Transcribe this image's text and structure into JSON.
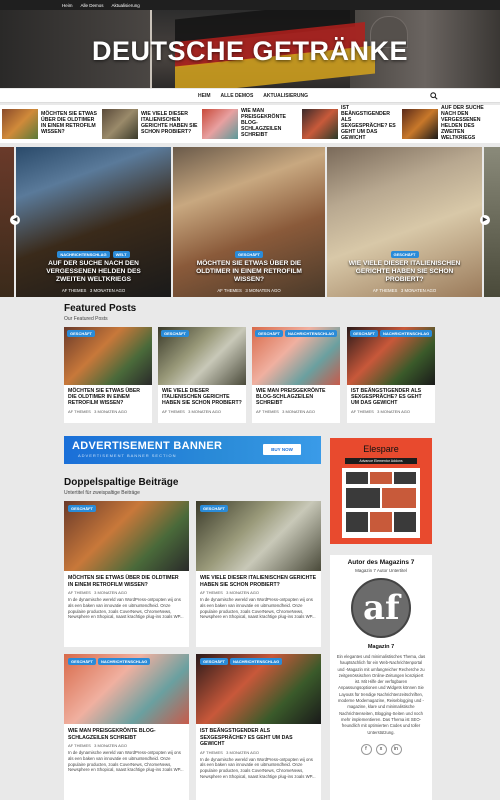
{
  "topbar": {
    "items": [
      "Heim",
      "Alle Demos",
      "Aktualisierung"
    ]
  },
  "site": {
    "title": "DEUTSCHE GETRÄNKE"
  },
  "nav": {
    "items": [
      "HEIM",
      "ALLE DEMOS",
      "AKTUALISIERUNG"
    ],
    "search_icon": "search-icon"
  },
  "ticker": [
    {
      "title": "MÖCHTEN SIE ETWAS ÜBER DIE OLDTIMER IN EINEM RETROFILM WISSEN?"
    },
    {
      "title": "WIE VIELE DIESER ITALIENISCHEN GERICHTE HABEN SIE SCHON PROBIERT?"
    },
    {
      "title": "WIE MAN PREISGEKRÖNTE BLOG-SCHLAGZEILEN SCHREIBT"
    },
    {
      "title": "IST BEÄNGSTIGENDER ALS SEXGESPRÄCHE? ES GEHT UM DAS GEWICHT"
    },
    {
      "title": "AUF DER SUCHE NACH DEN VERGESSENEN HELDEN DES ZWEITEN WELTKRIEGS"
    }
  ],
  "slides": [
    {
      "badges": [
        "NACHRICHTENSCHLAG",
        "WELT"
      ],
      "title": "AUF DER SUCHE NACH DEN VERGESSENEN HELDEN DES ZWEITEN WELTKRIEGS",
      "author": "AF THEMES",
      "date": "3 MONATEN AGO"
    },
    {
      "badges": [
        "GESCHÄFT"
      ],
      "title": "MÖCHTEN SIE ETWAS ÜBER DIE OLDTIMER IN EINEM RETROFILM WISSEN?",
      "author": "AF THEMES",
      "date": "3 MONATEN AGO"
    },
    {
      "badges": [
        "GESCHÄFT"
      ],
      "title": "WIE VIELE DIESER ITALIENISCHEN GERICHTE HABEN SIE SCHON PROBIERT?",
      "author": "AF THEMES",
      "date": "3 MONATEN AGO"
    }
  ],
  "featured": {
    "title": "Featured Posts",
    "subtitle": "Our Featured Posts",
    "posts": [
      {
        "badges": [
          "GESCHÄFT"
        ],
        "title": "MÖCHTEN SIE ETWAS ÜBER DIE OLDTIMER IN EINEM RETROFILM WISSEN?",
        "author": "AF THEMES",
        "date": "3 MONATEN AGO"
      },
      {
        "badges": [
          "GESCHÄFT"
        ],
        "title": "WIE VIELE DIESER ITALIENISCHEN GERICHTE HABEN SIE SCHON PROBIERT?",
        "author": "AF THEMES",
        "date": "3 MONATEN AGO"
      },
      {
        "badges": [
          "GESCHÄFT",
          "NACHRICHTENSCHLAG"
        ],
        "title": "WIE MAN PREISGEKRÖNTE BLOG-SCHLAGZEILEN SCHREIBT",
        "author": "AF THEMES",
        "date": "3 MONATEN AGO"
      },
      {
        "badges": [
          "GESCHÄFT",
          "NACHRICHTENSCHLAG"
        ],
        "title": "IST BEÄNGSTIGENDER ALS SEXGESPRÄCHE? ES GEHT UM DAS GEWICHT",
        "author": "AF THEMES",
        "date": "3 MONATEN AGO"
      }
    ]
  },
  "ad": {
    "title": "ADVERTISEMENT BANNER",
    "subtitle": "ADVERTISEMENT BANNER SECTION",
    "button": "BUY NOW"
  },
  "twocol": {
    "title": "Doppelspaltige Beiträge",
    "subtitle": "Untertitel für zweispaltige Beiträge",
    "posts": [
      {
        "badges": [
          "GESCHÄFT"
        ],
        "title": "MÖCHTEN SIE ETWAS ÜBER DIE OLDTIMER IN EINEM RETROFILM WISSEN?",
        "author": "AF THEMES",
        "date": "3 MONATEN AGO",
        "excerpt": "In de dynamische wereld van WordPress-ontpopten wij ons als een baken van innovatie en uitmuntendheid. Onze populaire producten, zoals CoverNews, ChromeNews, Newsphere en Shopical, naast krachtige plug-ins zoals WP..."
      },
      {
        "badges": [
          "GESCHÄFT"
        ],
        "title": "WIE VIELE DIESER ITALIENISCHEN GERICHTE HABEN SIE SCHON PROBIERT?",
        "author": "AF THEMES",
        "date": "3 MONATEN AGO",
        "excerpt": "In de dynamische wereld van WordPress-ontpopten wij ons als een baken van innovatie en uitmuntendheid. Onze populaire producten, zoals CoverNews, ChromeNews, Newsphere en Shopical, naast krachtige plug-ins zoals WP..."
      },
      {
        "badges": [
          "GESCHÄFT",
          "NACHRICHTENSCHLAG"
        ],
        "title": "WIE MAN PREISGEKRÖNTE BLOG-SCHLAGZEILEN SCHREIBT",
        "author": "AF THEMES",
        "date": "3 MONATEN AGO",
        "excerpt": "In de dynamische wereld van WordPress-ontpopten wij ons als een baken van innovatie en uitmuntendheid. Onze populaire producten, zoals CoverNews, ChromeNews, Newsphere en Shopical, naast krachtige plug-ins zoals WP..."
      },
      {
        "badges": [
          "GESCHÄFT",
          "NACHRICHTENSCHLAG"
        ],
        "title": "IST BEÄNGSTIGENDER ALS SEXGESPRÄCHE? ES GEHT UM DAS GEWICHT",
        "author": "AF THEMES",
        "date": "3 MONATEN AGO",
        "excerpt": "In de dynamische wereld van WordPress-ontpopten wij ons als een baken van innovatie en uitmuntendheid. Onze populaire producten, zoals CoverNews, ChromeNews, Newsphere en Shopical, naast krachtige plug-ins zoals WP..."
      }
    ]
  },
  "elespare": {
    "name": "Elespare",
    "subtitle": "Advance Elementor Addons"
  },
  "author": {
    "heading": "Autor des Magazins 7",
    "subtitle": "Magazin 7 Autor Untertitel",
    "logo_text": "af",
    "name": "Magazin 7",
    "description": "Ein elegantes und minimalistisches Thema, das hauptsächlich für ein Web-Nachrichtenportal und -Magazin mit umfangreicher Recherche zu zeitgenössischen Online-Zeitungen konzipiert ist. Mit Hilfe der verfügbaren Anpassungsoptionen und Widgets können Sie Layouts für trendige Nachrichtenzeitschriften, moderne Modemagazine, Reiseblogging und -magazine, klare und minimalistische Nachrichtenseiten, Blogging-Seiten und noch mehr implementieren. Das Thema ist SEO-freundlich mit optimierten Codes und toller Unterstützung.",
    "social": [
      "f",
      "x",
      "in"
    ]
  },
  "colors": {
    "accent": "#2a8bd8",
    "topbar": "#1f1f1f"
  }
}
